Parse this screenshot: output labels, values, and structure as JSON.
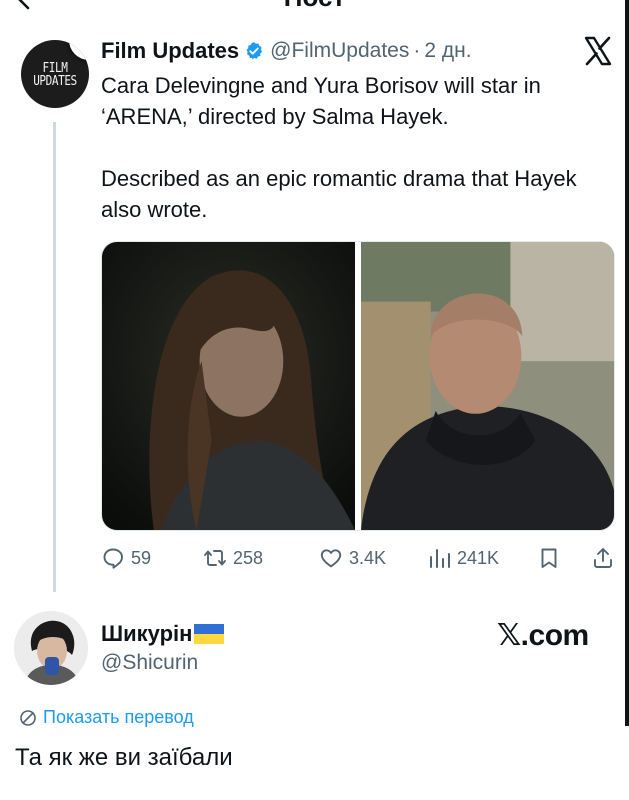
{
  "header": {
    "title": "Пост",
    "back_icon": "chevron-left-icon"
  },
  "original_post": {
    "avatar_text": [
      "FILM",
      "UPDATES"
    ],
    "author_name": "Film Updates",
    "verified": true,
    "handle": "@FilmUpdates",
    "separator": "·",
    "time": "2 дн.",
    "paragraphs": [
      "Cara Delevingne and Yura Borisov will star in ‘ARENA,’ directed by Salma Hayek.",
      "Described as an epic romantic drama that Hayek also wrote."
    ],
    "media_count": 2,
    "actions": {
      "replies": "59",
      "reposts": "258",
      "likes": "3.4K",
      "views": "241K"
    }
  },
  "quote_post": {
    "name": "Шикурін",
    "flag": "ukraine-flag",
    "handle": "@Shicurin",
    "watermark": "𝕏.com",
    "translate_label": "Показать перевод",
    "text": "Та як же ви заїбали"
  },
  "colors": {
    "text": "#0f1419",
    "secondary": "#536471",
    "link": "#1d9bf0",
    "verified": "#1d9bf0",
    "thread_line": "#cfd9de"
  }
}
